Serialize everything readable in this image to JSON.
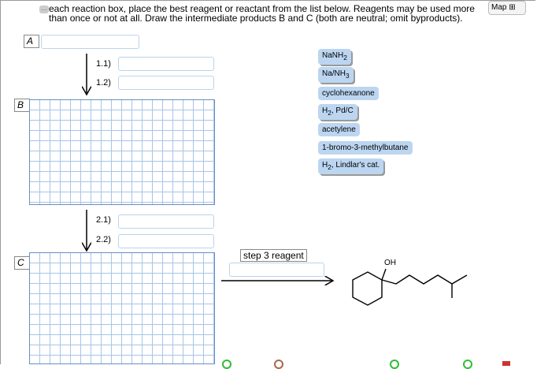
{
  "instructions": "each reaction box, place the best reagent or reactant from the list below. Reagents may be used more than once or not at all. Draw the intermediate products B and C (both are neutral; omit byproducts).",
  "map_button": "Map",
  "labels": {
    "a": "A",
    "b": "B",
    "c": "C"
  },
  "steps": {
    "s11": "1.1)",
    "s12": "1.2)",
    "s21": "2.1)",
    "s22": "2.2)",
    "s3": "step 3 reagent"
  },
  "reagents": [
    {
      "main": "NaNH",
      "sub": "2",
      "rest": ""
    },
    {
      "main": "Na/NH",
      "sub": "3",
      "rest": ""
    },
    {
      "main": "cyclohexanone",
      "sub": "",
      "rest": ""
    },
    {
      "main": "H",
      "sub": "2",
      "rest": ", Pd/C"
    },
    {
      "main": "acetylene",
      "sub": "",
      "rest": ""
    },
    {
      "main": "1-bromo-3-methylbutane",
      "sub": "",
      "rest": ""
    },
    {
      "main": "H",
      "sub": "2",
      "rest": ", Lindlar's cat."
    }
  ],
  "product": {
    "oh_label": "OH"
  }
}
